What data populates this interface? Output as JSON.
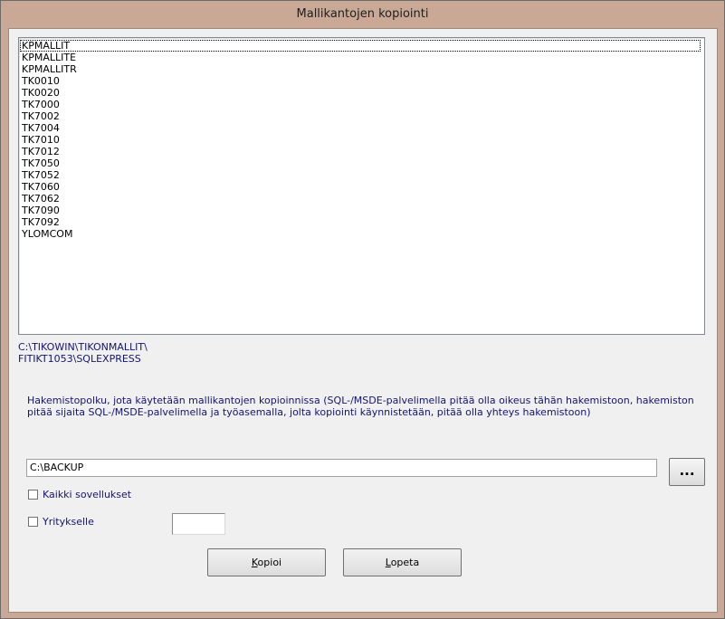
{
  "window": {
    "title": "Mallikantojen kopiointi"
  },
  "list": {
    "items": [
      "KPMALLIT",
      "KPMALLITE",
      "KPMALLITR",
      "TK0010",
      "TK0020",
      "TK7000",
      "TK7002",
      "TK7004",
      "TK7010",
      "TK7012",
      "TK7050",
      "TK7052",
      "TK7060",
      "TK7062",
      "TK7090",
      "TK7092",
      "YLOMCOM"
    ],
    "selected": "KPMALLIT"
  },
  "paths": {
    "local_path": "C:\\TIKOWIN\\TIKONMALLIT\\",
    "server": "FITIKT1053\\SQLEXPRESS"
  },
  "description": "Hakemistopolku, jota käytetään mallikantojen kopioinnissa (SQL-/MSDE-palvelimella pitää olla oikeus tähän hakemistoon, hakemiston pitää sijaita SQL-/MSDE-palvelimella ja työasemalla, jolta kopiointi käynnistetään, pitää olla yhteys hakemistoon)",
  "backup_path": {
    "value": "C:\\BACKUP"
  },
  "browse_button": {
    "label": "..."
  },
  "options": {
    "all_apps_label": "Kaikki sovellukset",
    "all_apps_checked": false,
    "company_label": "Yritykselle",
    "company_checked": false,
    "company_value": ""
  },
  "buttons": {
    "copy_label_underlined": "K",
    "copy_label_rest": "opioi",
    "quit_label_underlined": "L",
    "quit_label_rest": "opeta"
  }
}
